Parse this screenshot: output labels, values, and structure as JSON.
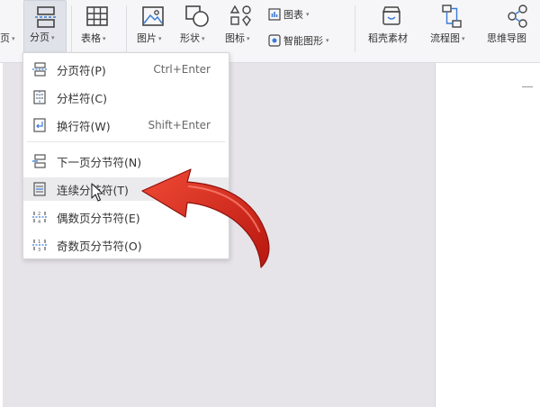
{
  "ribbon": {
    "partial_left_label": "页",
    "fenye": "分页",
    "biaoge": "表格",
    "tupian": "图片",
    "xingzhuang": "形状",
    "tubiao": "图标",
    "chart": "图表",
    "smartart": "智能图形",
    "daoke": "稻壳素材",
    "liucheng": "流程图",
    "siwei": "思维导图"
  },
  "menu": {
    "items": [
      {
        "label": "分页符(P)",
        "shortcut": "Ctrl+Enter"
      },
      {
        "label": "分栏符(C)",
        "shortcut": ""
      },
      {
        "label": "换行符(W)",
        "shortcut": "Shift+Enter"
      },
      {
        "label": "下一页分节符(N)",
        "shortcut": ""
      },
      {
        "label": "连续分节符(T)",
        "shortcut": ""
      },
      {
        "label": "偶数页分节符(E)",
        "shortcut": ""
      },
      {
        "label": "奇数页分节符(O)",
        "shortcut": ""
      }
    ]
  },
  "colors": {
    "accent_blue": "#3a7bd5",
    "arrow_red": "#d8261c"
  }
}
